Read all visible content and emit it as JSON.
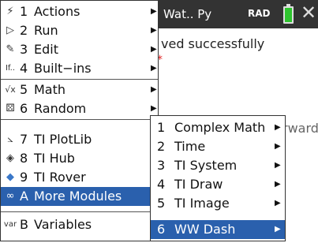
{
  "status_bar": {
    "title": "Wat.. Py",
    "mode": "RAD"
  },
  "content": {
    "line1": "ved successfully",
    "line2": "rward"
  },
  "main_menu": {
    "items": [
      {
        "icon": "lightning-icon",
        "glyph": "⚡",
        "num": "1",
        "label": "Actions",
        "has_submenu": true,
        "selected": false
      },
      {
        "icon": "play-icon",
        "glyph": "▷",
        "num": "2",
        "label": "Run",
        "has_submenu": true,
        "selected": false
      },
      {
        "icon": "edit-icon",
        "glyph": "✎",
        "num": "3",
        "label": "Edit",
        "has_submenu": true,
        "selected": false
      },
      {
        "icon": "if-icon",
        "glyph": "If..",
        "num": "4",
        "label": "Built−ins",
        "has_submenu": true,
        "selected": false
      },
      {
        "icon": "sqrt-icon",
        "glyph": "√x",
        "num": "5",
        "label": "Math",
        "has_submenu": true,
        "selected": false
      },
      {
        "icon": "dice-icon",
        "glyph": "⚄",
        "num": "6",
        "label": "Random",
        "has_submenu": true,
        "selected": false
      },
      {
        "icon": "chart-icon",
        "glyph": "⦣",
        "num": "7",
        "label": "TI PlotLib",
        "has_submenu": false,
        "selected": false
      },
      {
        "icon": "hub-icon",
        "glyph": "◈",
        "num": "8",
        "label": "TI Hub",
        "has_submenu": false,
        "selected": false
      },
      {
        "icon": "rover-icon",
        "glyph": "◆",
        "num": "9",
        "label": "TI Rover",
        "has_submenu": false,
        "selected": false
      },
      {
        "icon": "modules-icon",
        "glyph": "∞",
        "num": "A",
        "label": "More Modules",
        "has_submenu": false,
        "selected": true
      },
      {
        "icon": "var-icon",
        "glyph": "var",
        "num": "B",
        "label": "Variables",
        "has_submenu": false,
        "selected": false
      }
    ]
  },
  "sub_menu": {
    "items": [
      {
        "num": "1",
        "label": "Complex Math",
        "has_submenu": true,
        "selected": false
      },
      {
        "num": "2",
        "label": "Time",
        "has_submenu": true,
        "selected": false
      },
      {
        "num": "3",
        "label": "TI System",
        "has_submenu": true,
        "selected": false
      },
      {
        "num": "4",
        "label": "TI Draw",
        "has_submenu": true,
        "selected": false
      },
      {
        "num": "5",
        "label": "TI Image",
        "has_submenu": true,
        "selected": false
      },
      {
        "num": "6",
        "label": "WW Dash",
        "has_submenu": true,
        "selected": true
      }
    ]
  },
  "colors": {
    "selection": "#2a60ad",
    "top_bar": "#333333",
    "battery": "#2ec42e"
  }
}
